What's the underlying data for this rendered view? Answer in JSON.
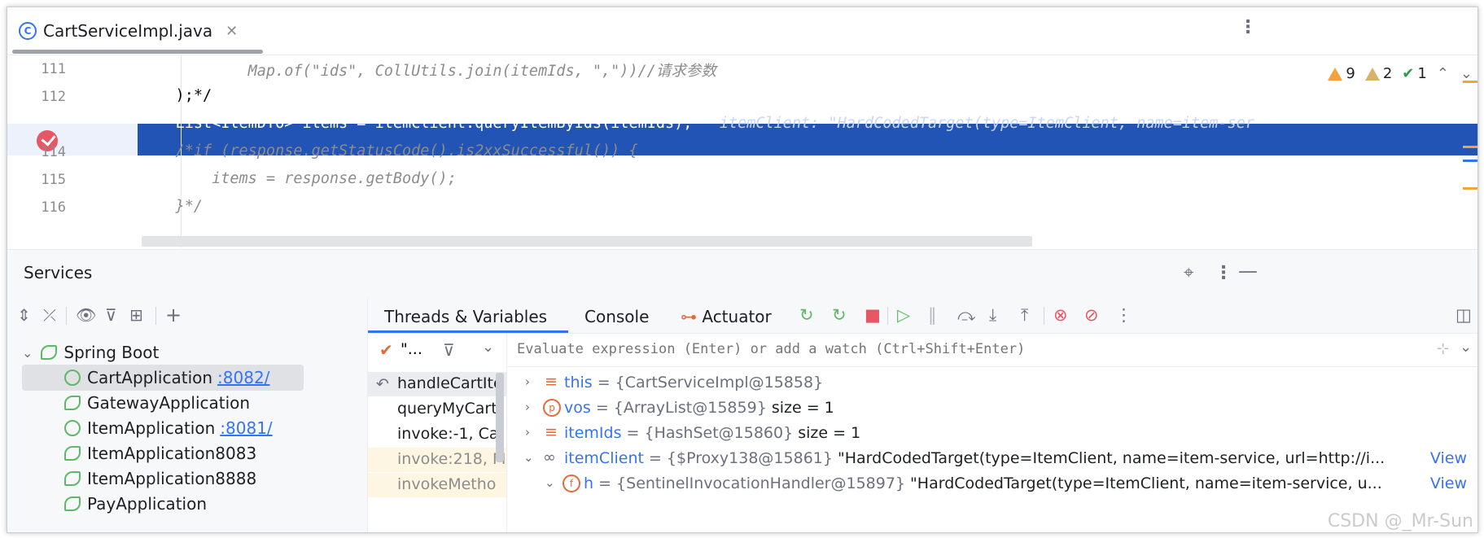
{
  "editor": {
    "tab_label": "CartServiceImpl.java",
    "tab_icon": "class-icon",
    "lines": [
      {
        "num": "111",
        "text": "            Map.of(\"ids\", CollUtils.join(itemIds, \",\"))//请求参数",
        "style": "comment"
      },
      {
        "num": "112",
        "text": "    );*/",
        "style": "comment"
      },
      {
        "num": "113",
        "text": "    List<ItemDTO> items = itemClient.queryItemByIds(itemIds);",
        "hint": "itemClient: \"HardCodedTarget(type=ItemClient, name=item-ser",
        "style": "current"
      },
      {
        "num": "114",
        "text": "    /*if (response.getStatusCode().is2xxSuccessful()) {",
        "style": "comment"
      },
      {
        "num": "115",
        "text": "        items = response.getBody();",
        "style": "comment"
      },
      {
        "num": "116",
        "text": "    }*/",
        "style": "comment"
      }
    ],
    "inspection": {
      "warnings": "9",
      "weak_warnings": "2",
      "typos": "1"
    }
  },
  "services": {
    "title": "Services",
    "tree": {
      "root": "Spring Boot",
      "items": [
        {
          "name": "CartApplication",
          "port": ":8082/",
          "icon": "debug-icon",
          "selected": true
        },
        {
          "name": "GatewayApplication",
          "port": "",
          "icon": "run-icon"
        },
        {
          "name": "ItemApplication",
          "port": ":8081/",
          "icon": "debug-icon"
        },
        {
          "name": "ItemApplication8083",
          "port": "",
          "icon": "run-icon"
        },
        {
          "name": "ItemApplication8888",
          "port": "",
          "icon": "run-icon"
        },
        {
          "name": "PayApplication",
          "port": "",
          "icon": "run-icon"
        }
      ]
    }
  },
  "debugger": {
    "tabs": [
      "Threads & Variables",
      "Console",
      "Actuator"
    ],
    "active_tab": "Threads & Variables",
    "thread_label": "\"...",
    "eval_placeholder": "Evaluate expression (Enter) or add a watch (Ctrl+Shift+Enter)",
    "frames": [
      {
        "text": "handleCartIte",
        "kind": "current"
      },
      {
        "text": "queryMyCart",
        "kind": "user"
      },
      {
        "text": "invoke:-1, Ca",
        "kind": "user"
      },
      {
        "text": "invoke:218, M",
        "kind": "lib"
      },
      {
        "text": "invokeMetho",
        "kind": "lib"
      }
    ],
    "variables": [
      {
        "name": "this",
        "value": " = {CartServiceImpl@15858}",
        "extra": "",
        "icon": "field-icon",
        "expanded": false,
        "indent": 0
      },
      {
        "name": "vos",
        "value": " = {ArrayList@15859}",
        "extra": "  size = 1",
        "icon": "parameter-icon",
        "expanded": false,
        "indent": 0
      },
      {
        "name": "itemIds",
        "value": " = {HashSet@15860}",
        "extra": "  size = 1",
        "icon": "field-icon",
        "expanded": false,
        "indent": 0
      },
      {
        "name": "itemClient",
        "value": " = {$Proxy138@15861}",
        "extra": " \"HardCodedTarget(type=ItemClient, name=item-service, url=http://i...",
        "view": "View",
        "icon": "watch-icon",
        "expanded": true,
        "indent": 0
      },
      {
        "name": "h",
        "value": " = {SentinelInvocationHandler@15897}",
        "extra": " \"HardCodedTarget(type=ItemClient, name=item-service, u...",
        "view": "View",
        "icon": "field-f-icon",
        "expanded": true,
        "indent": 1
      }
    ]
  },
  "watermark": "CSDN @_Mr-Sun",
  "colors": {
    "accent": "#3574f0",
    "current_line": "#2154b4",
    "breakpoint": "#e55765",
    "run_green": "#5fb865"
  }
}
